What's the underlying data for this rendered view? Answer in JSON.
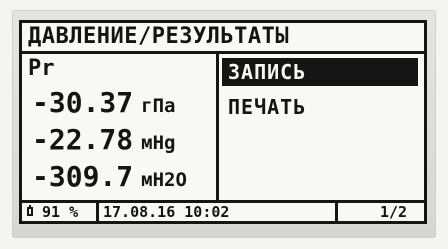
{
  "screen": {
    "title": "ДАВЛЕНИЕ/РЕЗУЛЬТАТЫ",
    "parameter": "Pr",
    "readings": [
      {
        "value": "-30.37",
        "unit": "гПа"
      },
      {
        "value": "-22.78",
        "unit": "мНg"
      },
      {
        "value": "-309.7",
        "unit": "мН2О"
      }
    ],
    "menu": [
      {
        "label": "ЗАПИСЬ",
        "selected": true
      },
      {
        "label": "ПЕЧАТЬ",
        "selected": false
      }
    ],
    "status": {
      "battery_icon": "battery-icon",
      "battery": "91 %",
      "datetime": "17.08.16 10:02",
      "page": "1/2"
    }
  }
}
